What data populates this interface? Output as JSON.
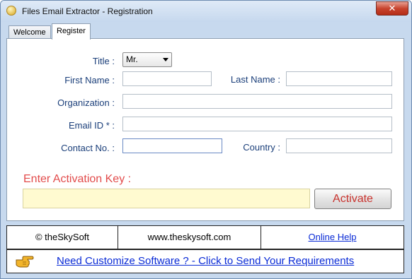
{
  "window": {
    "title": "Files Email Extractor  - Registration",
    "close_label": "✕"
  },
  "tabs": [
    {
      "label": "Welcome"
    },
    {
      "label": "Register"
    }
  ],
  "form": {
    "title_label": "Title :",
    "title_value": "Mr.",
    "first_name_label": "First Name :",
    "last_name_label": "Last Name :",
    "organization_label": "Organization :",
    "email_label": "Email ID * :",
    "contact_label": "Contact No. :",
    "country_label": "Country :"
  },
  "activation": {
    "label": "Enter Activation Key  :",
    "button_label": "Activate"
  },
  "footer": {
    "copyright": "© theSkySoft",
    "website": "www.theskysoft.com",
    "help_link": "Online Help",
    "customize_link": "Need Customize Software ? - Click to Send Your Requirements"
  },
  "colors": {
    "label": "#1b3f7a",
    "activation_label": "#e24c4c",
    "link": "#0a2bd6",
    "key_field": "#fffad0"
  }
}
